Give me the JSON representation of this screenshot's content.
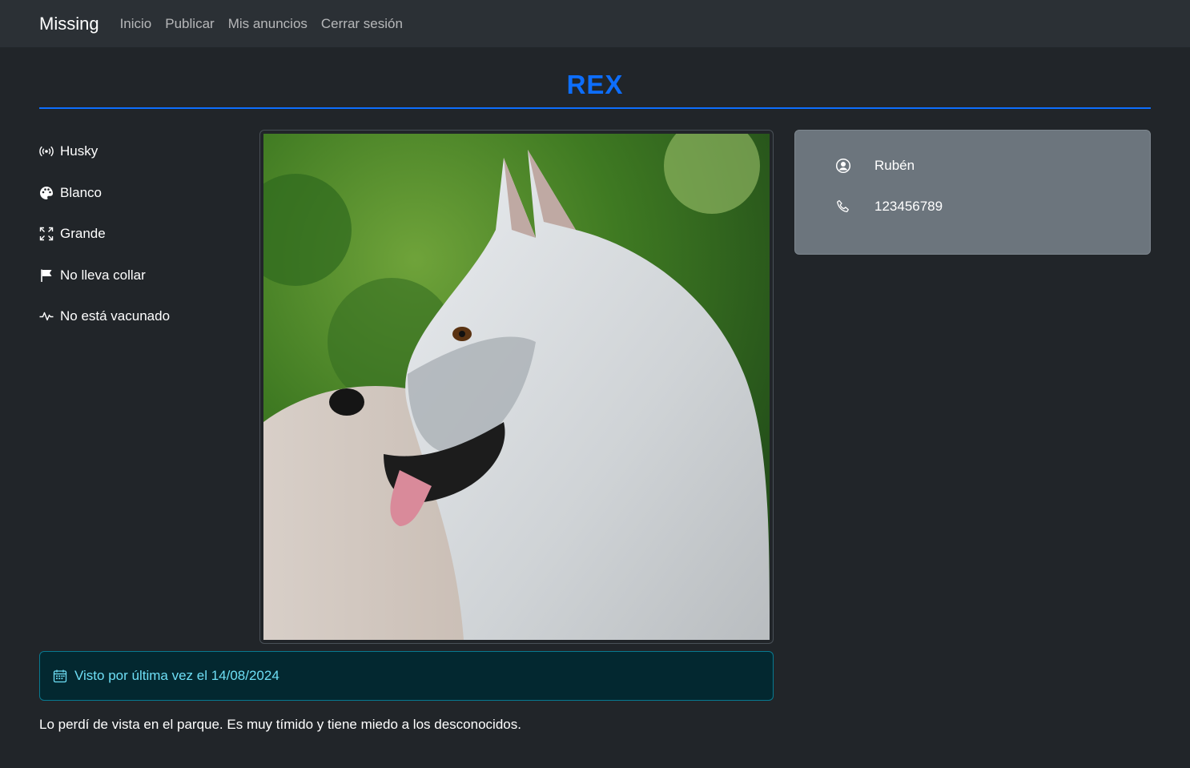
{
  "nav": {
    "brand": "Missing",
    "links": [
      "Inicio",
      "Publicar",
      "Mis anuncios",
      "Cerrar sesión"
    ]
  },
  "pet": {
    "name": "REX",
    "features": [
      {
        "icon": "broadcast-icon",
        "label": "Husky"
      },
      {
        "icon": "palette-icon",
        "label": "Blanco"
      },
      {
        "icon": "expand-arrows-icon",
        "label": "Grande"
      },
      {
        "icon": "flag-icon",
        "label": "No lleva collar"
      },
      {
        "icon": "pulse-icon",
        "label": "No está vacunado"
      }
    ],
    "photo_alt": "husky-photo"
  },
  "contact": {
    "name": "Rubén",
    "phone": "123456789"
  },
  "last_seen": "Visto por última vez el 14/08/2024",
  "description": "Lo perdí de vista en el parque. Es muy tímido y tiene miedo a los desconocidos.",
  "colors": {
    "background": "#212529",
    "navbar": "#2b3035",
    "accent": "#0d6efd",
    "contact_card": "#6c757d",
    "alert_bg": "#032830",
    "alert_text": "#6edff6"
  }
}
